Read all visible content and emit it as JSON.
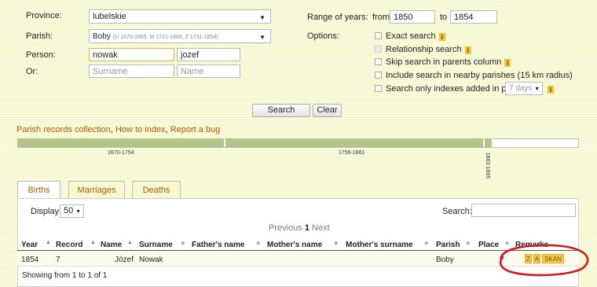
{
  "form": {
    "province_label": "Province:",
    "province_value": "lubelskie",
    "parish_label": "Parish:",
    "parish_value": "Boby",
    "parish_detail": "(U 1670-1865, M 1721-1889, Z 1731-1854)",
    "person_label": "Person:",
    "person_surname": "nowak",
    "person_name": "jozef",
    "or_label": "Or:",
    "or_surname_placeholder": "Surname",
    "or_name_placeholder": "Name",
    "range_label": "Range of years:",
    "from_label": "from",
    "from_value": "1850",
    "to_label": "to",
    "to_value": "1854",
    "options_label": "Options:",
    "options": [
      {
        "label": "Exact search",
        "info": true
      },
      {
        "label": "Relationship search",
        "info": true
      },
      {
        "label": "Skip search in parents column",
        "info": true
      },
      {
        "label": "Include search in nearby parishes (15 km radius)",
        "info": false
      },
      {
        "label": "Search only indexes added in past",
        "info": true
      }
    ],
    "past_select": "7 days",
    "info_glyph": "i",
    "search_button": "Search",
    "clear_button": "Clear"
  },
  "links": {
    "collection": "Parish records collection",
    "how_to": "How to index",
    "bug": "Report a bug",
    "sep": ", "
  },
  "timeline": {
    "labels": [
      "1670-1754",
      "1756-1861",
      "1863-1865"
    ]
  },
  "tabs": [
    "Births",
    "Marriages",
    "Deaths"
  ],
  "table": {
    "display_label": "Display",
    "display_value": "50",
    "search_label": "Search:",
    "pager_prev": "Previous",
    "pager_page": "1",
    "pager_next": "Next",
    "columns": [
      "Year",
      "Record",
      "Name",
      "Surname",
      "Father's name",
      "Mother's name",
      "Mother's surname",
      "Parish",
      "Place",
      "Remarks"
    ],
    "row": {
      "year": "1854",
      "record": "7",
      "name": "Józef",
      "surname": "Nowak",
      "parish": "Boby",
      "remarks": [
        "Z",
        "A",
        "SKAN"
      ]
    },
    "footer": "Showing from 1 to 1 of 1"
  },
  "colors": {
    "page_bg": "#f6f8d2",
    "link": "#b35a00",
    "timeline": "#b3c486",
    "highlight_ring": "#d9151c"
  }
}
